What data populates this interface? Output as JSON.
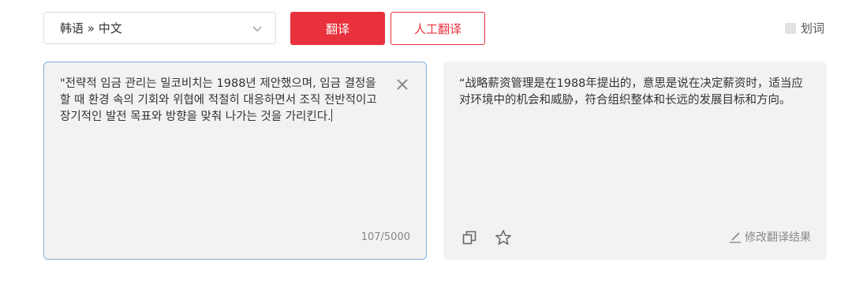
{
  "toolbar": {
    "language_pair": "韩语 » 中文",
    "translate_label": "翻译",
    "human_translate_label": "人工翻译",
    "word_select_label": "划词"
  },
  "source": {
    "text": "\"전략적 임금 관리는 밀코비치는 1988년 제안했으며, 임금 결정을 할 때 환경 속의 기회와 위협에 적절히 대응하면서 조직 전반적이고 장기적인 발전 목표와 방향을 맞춰 나가는 것을 가리킨다.",
    "char_count": "107/5000"
  },
  "target": {
    "text": "“战略薪资管理是在1988年提出的，意思是说在决定薪资时，适当应对环境中的机会和威胁，符合组织整体和长远的发展目标和方向。",
    "edit_label": "修改翻译结果"
  },
  "icons": {
    "dropdown": "chevron-down-icon",
    "clear": "close-icon",
    "copy": "copy-icon",
    "favorite": "star-icon",
    "edit": "pencil-icon"
  },
  "colors": {
    "accent": "#e8313d",
    "source_border": "#7fb3e0",
    "pane_background": "#f2f2f2"
  }
}
